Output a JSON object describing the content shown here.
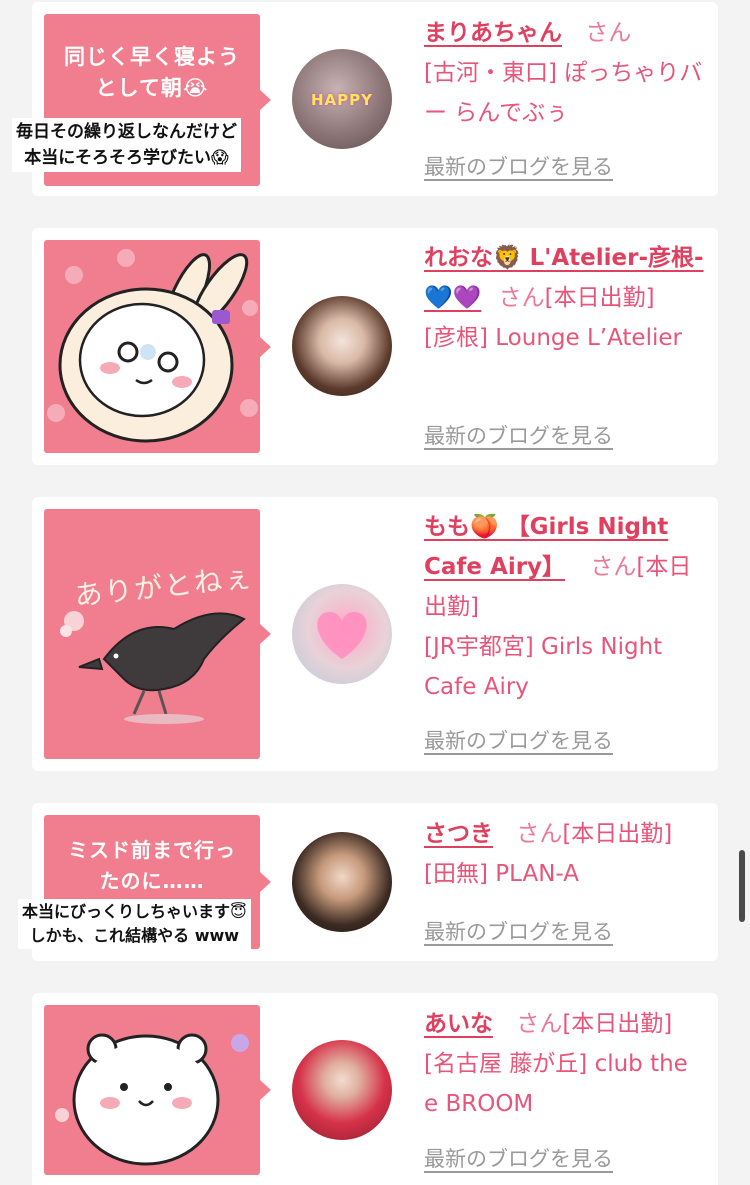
{
  "colors": {
    "accent": "#e0405f",
    "bubble": "#f07e8f",
    "link_gray": "#9a9a9a",
    "background": "#f3f3f3"
  },
  "cards": [
    {
      "bubble_lines": [
        "同じく早く寝よう",
        "として朝😭"
      ],
      "caption_lines": [
        "毎日その繰り返しなんだけど",
        "本当にそろそろ学びたい😱"
      ],
      "avatar_text": "HAPPY",
      "name": "まりあちゃん",
      "honorific": "さん",
      "status": "",
      "shop": "[古河・東口] ぽっちゃりバー らんでぶぅ",
      "blog_link": "最新のブログを見る"
    },
    {
      "bubble_lines": [],
      "caption_lines": [],
      "avatar_text": "",
      "name": "れおな🦁 L'Atelier-彦根-💙💜",
      "honorific": "さん",
      "status": "[本日出勤]",
      "shop": "[彦根] Lounge L’Atelier",
      "blog_link": "最新のブログを見る"
    },
    {
      "bubble_lines": [
        "ありがとねぇ"
      ],
      "caption_lines": [],
      "avatar_text": "",
      "name": "もも🍑 【Girls Night Cafe Airy】",
      "honorific": "さん",
      "status": "[本日出勤]",
      "shop": "[JR宇都宮] Girls Night Cafe Airy",
      "blog_link": "最新のブログを見る"
    },
    {
      "bubble_lines": [
        "ミスド前まで行っ",
        "たのに……"
      ],
      "caption_lines": [
        "本当にびっくりしちゃいます😇",
        "しかも、これ結構やる www"
      ],
      "avatar_text": "",
      "name": "さつき",
      "honorific": "さん",
      "status": "[本日出勤]",
      "shop": "[田無] PLAN-A",
      "blog_link": "最新のブログを見る"
    },
    {
      "bubble_lines": [],
      "caption_lines": [],
      "avatar_text": "",
      "name": "あいな",
      "honorific": "さん",
      "status": "[本日出勤]",
      "shop": "[名古屋 藤が丘] club the e BROOM",
      "blog_link": "最新のブログを見る"
    }
  ]
}
